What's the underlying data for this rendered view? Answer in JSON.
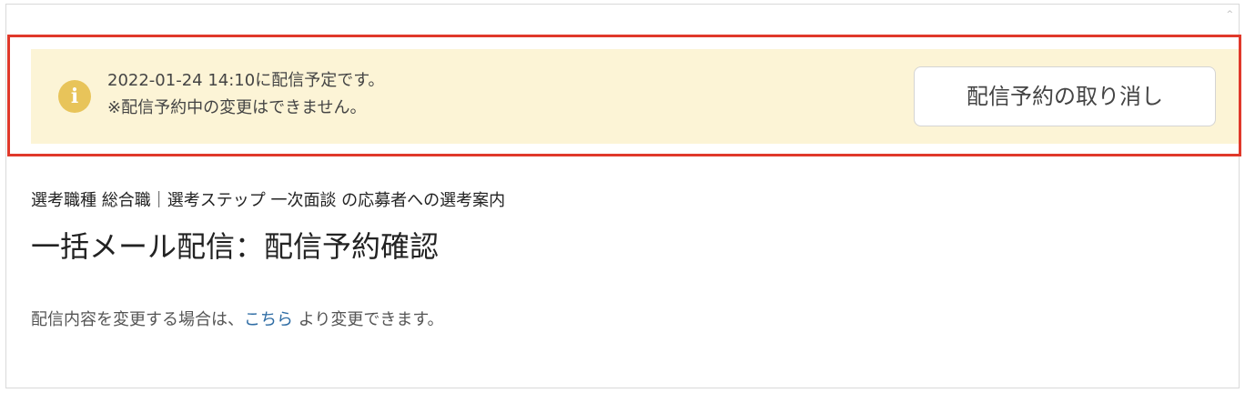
{
  "notice": {
    "icon": "info-icon",
    "icon_glyph": "i",
    "icon_color": "#e8c45a",
    "background_color": "#fcf4d6",
    "line1": "2022-01-24 14:10に配信予定です。",
    "line2": "※配信予約中の変更はできません。",
    "cancel_label": "配信予約の取り消し"
  },
  "highlight_color": "#e0392b",
  "header": {
    "subtitle": "選考職種 総合職｜選考ステップ 一次面談 の応募者への選考案内",
    "title": "一括メール配信：配信予約確認"
  },
  "info": {
    "prefix": "配信内容を変更する場合は、",
    "link": "こちら",
    "suffix": " より変更できます。",
    "link_color": "#2e6ca4"
  },
  "scroll_marker": "^"
}
